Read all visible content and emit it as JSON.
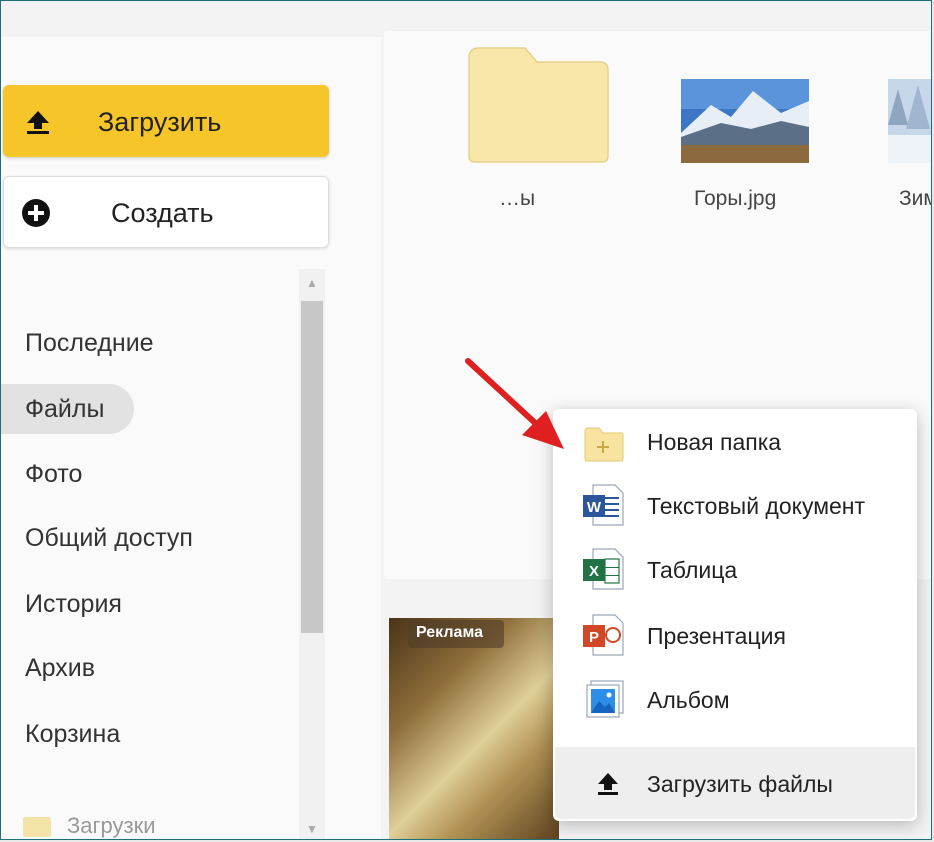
{
  "sidebar": {
    "upload_label": "Загрузить",
    "create_label": "Создать",
    "nav": [
      "Последние",
      "Файлы",
      "Фото",
      "Общий доступ",
      "История",
      "Архив",
      "Корзина"
    ],
    "active_nav": "Файлы",
    "downloads_label": "Загрузки"
  },
  "files": [
    {
      "name": "…ы",
      "icon": "folder-icon"
    },
    {
      "name": "Горы.jpg",
      "icon": "mountain-image-thumbnail"
    },
    {
      "name": "Зим",
      "icon": "winter-image-thumbnail"
    }
  ],
  "ad": {
    "badge": "Реклама"
  },
  "create_menu": {
    "items": [
      {
        "label": "Новая папка",
        "icon": "new-folder-icon"
      },
      {
        "label": "Текстовый документ",
        "icon": "word-document-icon"
      },
      {
        "label": "Таблица",
        "icon": "excel-spreadsheet-icon"
      },
      {
        "label": "Презентация",
        "icon": "powerpoint-presentation-icon"
      },
      {
        "label": "Альбом",
        "icon": "album-icon"
      }
    ],
    "upload_files_label": "Загрузить файлы"
  },
  "colors": {
    "upload_button": "#f5c52a",
    "arrow": "#e02020",
    "word": "#2b579a",
    "excel": "#217346",
    "powerpoint": "#d24726"
  }
}
